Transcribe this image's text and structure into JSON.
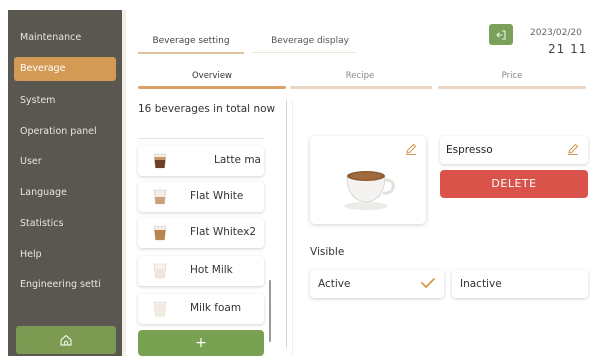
{
  "sidebar": {
    "items": [
      {
        "label": "Maintenance"
      },
      {
        "label": "Beverage"
      },
      {
        "label": "System"
      },
      {
        "label": "Operation panel"
      },
      {
        "label": "User"
      },
      {
        "label": "Language"
      },
      {
        "label": "Statistics"
      },
      {
        "label": "Help"
      },
      {
        "label": "Engineering setti"
      }
    ],
    "active_index": 1,
    "home_icon": "home-icon"
  },
  "header": {
    "tabs": [
      {
        "label": "Beverage setting"
      },
      {
        "label": "Beverage display"
      }
    ],
    "date": "2023/02/20",
    "time": "21 11",
    "exit_icon": "exit-icon"
  },
  "subtabs": [
    {
      "label": "Overview"
    },
    {
      "label": "Recipe"
    },
    {
      "label": "Price"
    }
  ],
  "list": {
    "count_text": "16 beverages in total now",
    "items": [
      {
        "label": "Latte ma"
      },
      {
        "label": "Flat White"
      },
      {
        "label": "Flat Whitex2"
      },
      {
        "label": "Hot Milk"
      },
      {
        "label": "Milk foam"
      }
    ],
    "add_label": "+"
  },
  "detail": {
    "name": "Espresso",
    "delete_label": "DELETE",
    "visible_label": "Visible",
    "active_label": "Active",
    "inactive_label": "Inactive"
  },
  "colors": {
    "sidebar_bg": "#5a5650",
    "accent_orange": "#d39a55",
    "accent_green": "#7ba05b",
    "delete_red": "#d9534a"
  }
}
